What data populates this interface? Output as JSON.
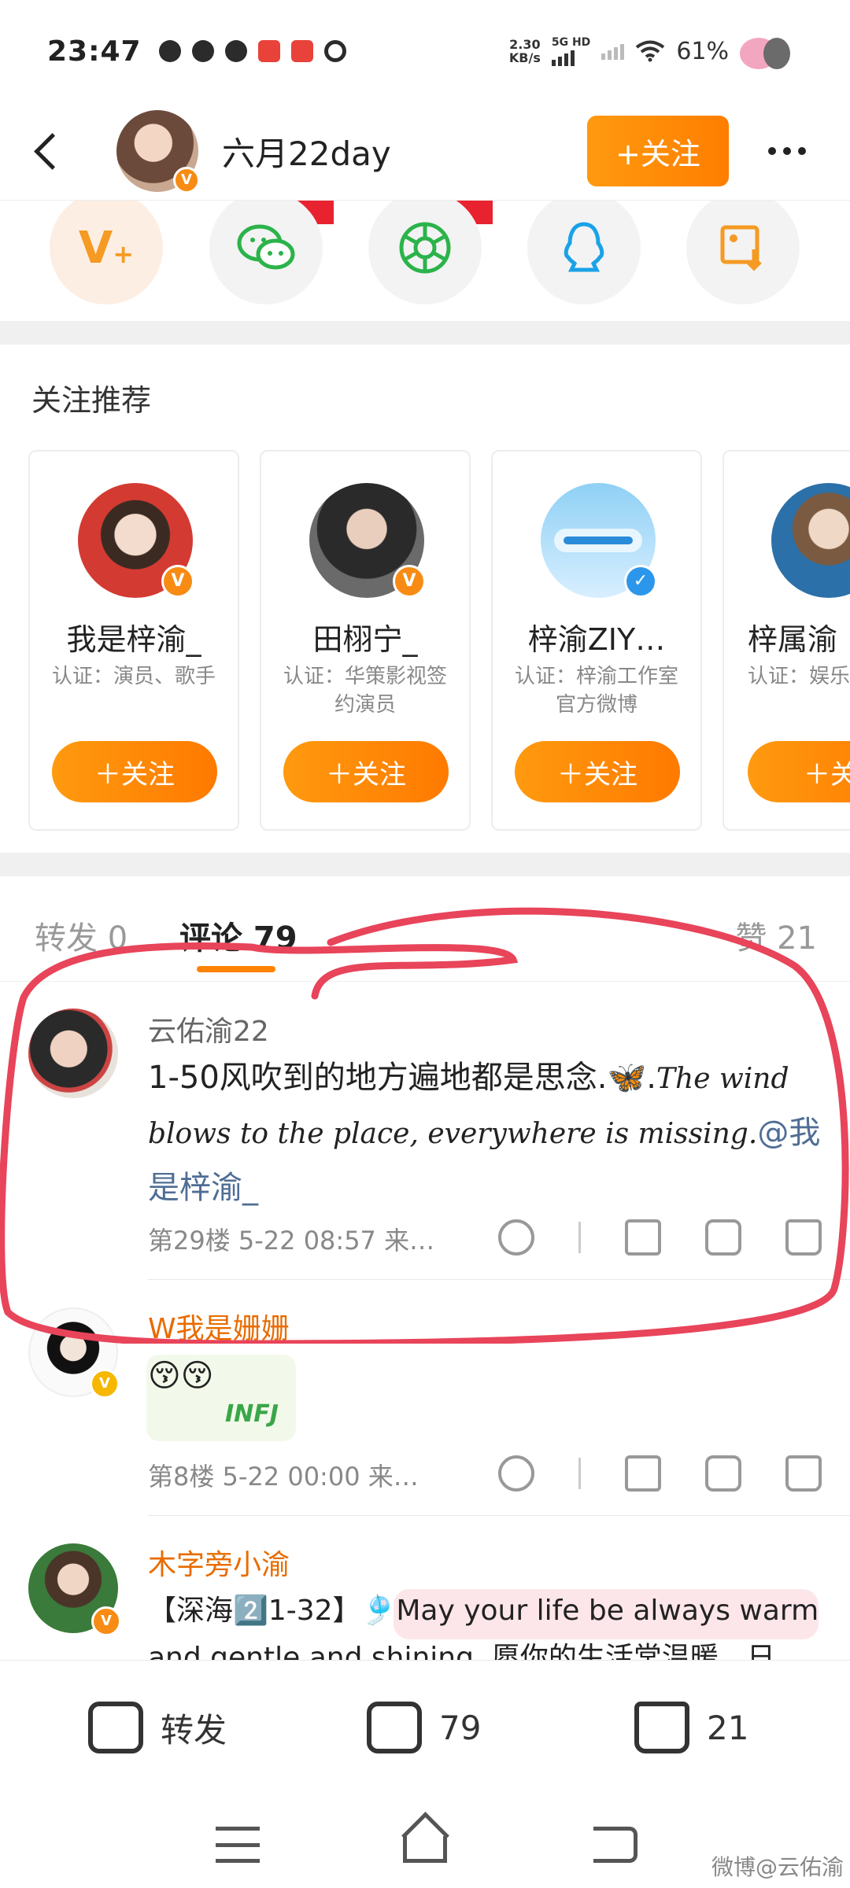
{
  "status_bar": {
    "time": "23:47",
    "net_speed_value": "2.30",
    "net_speed_unit": "KB/s",
    "net_type": "5G HD",
    "battery": "61%"
  },
  "header": {
    "back_icon": "back-icon",
    "username": "六月22day",
    "follow_label": "+关注",
    "more_icon": "more-icon"
  },
  "share_targets": [
    {
      "icon": "weibo-vip-icon",
      "color": "#f59a23"
    },
    {
      "icon": "wechat-icon",
      "color": "#2bb34a"
    },
    {
      "icon": "moments-icon",
      "color": "#2bb34a"
    },
    {
      "icon": "qq-icon",
      "color": "#1aa2e8"
    },
    {
      "icon": "save-image-icon",
      "color": "#f59a23"
    }
  ],
  "recommend": {
    "title": "关注推荐",
    "cards": [
      {
        "name": "我是梓渝_",
        "desc": "认证：演员、歌手",
        "follow": "＋关注"
      },
      {
        "name": "田栩宁_",
        "desc": "认证：华策影视签约演员",
        "follow": "＋关注"
      },
      {
        "name": "梓渝ZIY…",
        "desc": "认证：梓渝工作室官方微博",
        "follow": "＋关注"
      },
      {
        "name": "梓属渝",
        "desc": "认证：娱乐",
        "follow": "＋关"
      }
    ]
  },
  "tabs": {
    "repost": "转发 0",
    "comments": "评论 79",
    "likes": "赞 21"
  },
  "comments": [
    {
      "user": "云佑渝22",
      "text_main": "1-50风吹到的地方遍地都是思念.🦋.",
      "text_script": "The wind blows to the place, everywhere is missing.",
      "mention": "@我是梓渝_",
      "meta": "第29楼  5-22 08:57  来…"
    },
    {
      "user": "W我是姗姗",
      "text_main": "😚😚",
      "sticker_text": "INFJ",
      "meta": "第8楼  5-22 00:00  来…"
    },
    {
      "user": "木字旁小渝",
      "text_main": "【深海2️⃣1-32】🎐May your life be always warm and gentle and shining. 愿你的生活常温暖，日"
    }
  ],
  "bottom_bar": {
    "repost_label": "转发",
    "comment_count": "79",
    "like_count": "21"
  },
  "watermark": "微博@云佑渝",
  "colors": {
    "accent": "#ff8200",
    "annotation": "#e8445a",
    "mention": "#4f6d95"
  }
}
